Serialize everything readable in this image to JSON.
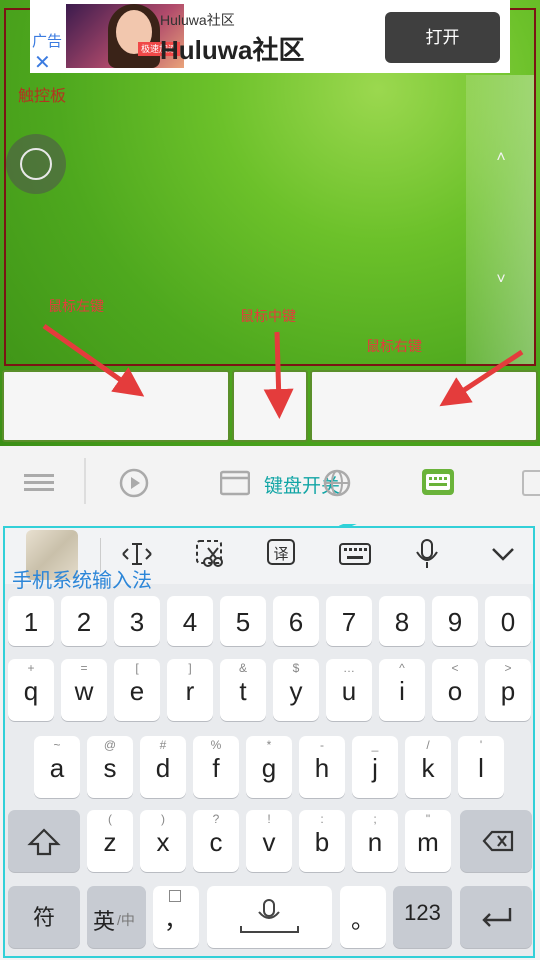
{
  "ad": {
    "small_title": "Huluwa社区",
    "title": "Huluwa社区",
    "open_button": "打开",
    "tag": "广告",
    "close": "✕",
    "img_badge": "极速加速"
  },
  "trackpad": {
    "label": "触控板",
    "scroll_up": "˄",
    "scroll_down": "˅"
  },
  "annotations": {
    "left_button": "鼠标左键",
    "middle_button": "鼠标中键",
    "right_button": "鼠标右键",
    "ime": "手机系统输入法"
  },
  "toolbar": {
    "keyboard_switch": "键盘开关"
  },
  "keyboard": {
    "numbers": [
      "1",
      "2",
      "3",
      "4",
      "5",
      "6",
      "7",
      "8",
      "9",
      "0"
    ],
    "row1": [
      [
        "+",
        "q"
      ],
      [
        "=",
        "w"
      ],
      [
        "[",
        "e"
      ],
      [
        "]",
        "r"
      ],
      [
        "&",
        "t"
      ],
      [
        "$",
        "y"
      ],
      [
        "…",
        "u"
      ],
      [
        "^",
        "i"
      ],
      [
        "<",
        "o"
      ],
      [
        ">",
        "p"
      ]
    ],
    "row2": [
      [
        "~",
        "a"
      ],
      [
        "@",
        "s"
      ],
      [
        "#",
        "d"
      ],
      [
        "%",
        "f"
      ],
      [
        "*",
        "g"
      ],
      [
        "-",
        "h"
      ],
      [
        "_",
        "j"
      ],
      [
        "/",
        "k"
      ],
      [
        "'",
        "l"
      ]
    ],
    "row3": [
      [
        "(",
        "z"
      ],
      [
        ")",
        "x"
      ],
      [
        "?",
        "c"
      ],
      [
        "!",
        "v"
      ],
      [
        ":",
        "b"
      ],
      [
        ";",
        "n"
      ],
      [
        "\"",
        "m"
      ]
    ],
    "symbols_key": "符",
    "lang_key_main": "英",
    "lang_key_alt": "/中",
    "comma": "，",
    "period": "。",
    "num_key": "123"
  }
}
